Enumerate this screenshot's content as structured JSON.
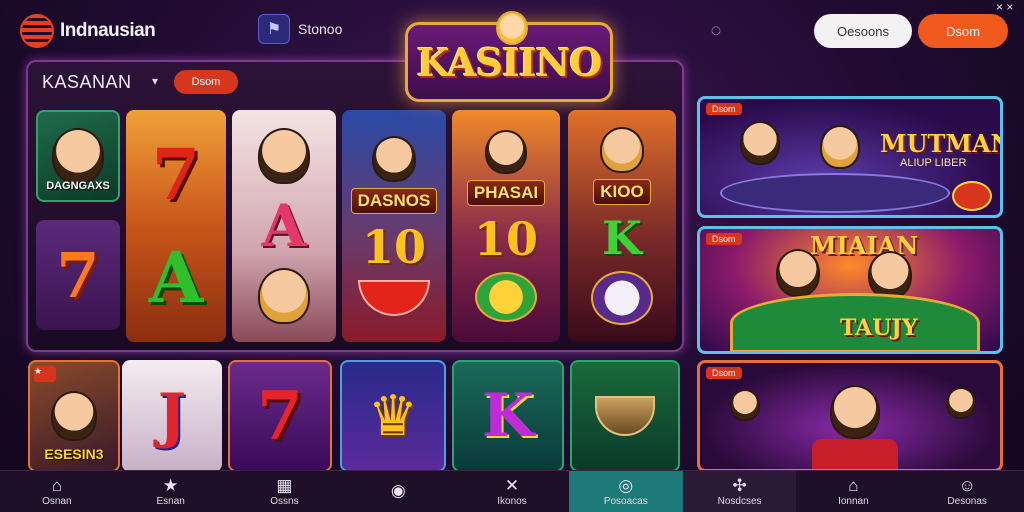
{
  "header": {
    "brand_name": "Indnausian",
    "store_label": "Stonoo",
    "logo_title": "KASIINO",
    "login_label": "Oesoons",
    "register_label": "Dsom",
    "close_glyph": "× ×"
  },
  "slot_panel": {
    "title": "KASANAN",
    "badge": "Dsom",
    "tiles": [
      {
        "caption": "DAGNGAXS"
      },
      {
        "symbol": "7"
      },
      {
        "symbol": "7"
      },
      {
        "symbol": "A"
      },
      {
        "symbol": "A"
      },
      {
        "label": "DASNOS",
        "value": "10"
      },
      {
        "label": "PHASAI",
        "value": "10"
      },
      {
        "label": "KIOO",
        "value": "K"
      }
    ]
  },
  "promos": [
    {
      "tag": "Dsom",
      "title": "MUTMANN",
      "subtitle": "ALIUP LIBER"
    },
    {
      "tag": "Dsom",
      "title": "MIAIAN",
      "subtitle": "TAUJY"
    },
    {
      "tag": "Dsom",
      "title": ""
    }
  ],
  "bottom_tiles": [
    {
      "caption": "ESESIN3"
    },
    {
      "symbol": "J"
    },
    {
      "symbol": "7"
    },
    {
      "symbol": ""
    },
    {
      "symbol": "K"
    },
    {
      "symbol": ""
    }
  ],
  "nav": [
    {
      "label": "Osnan",
      "icon": "home-icon",
      "glyph": "⌂"
    },
    {
      "label": "Esnan",
      "icon": "star-icon",
      "glyph": "★"
    },
    {
      "label": "Ossns",
      "icon": "grid-icon",
      "glyph": "▦"
    },
    {
      "label": "",
      "icon": "eye-icon",
      "glyph": "◉"
    },
    {
      "label": "Ikonos",
      "icon": "cross-icon",
      "glyph": "✕"
    },
    {
      "label": "Posoacas",
      "icon": "chip-icon",
      "glyph": "◎"
    },
    {
      "label": "Nosdcses",
      "icon": "deck-icon",
      "glyph": "✣"
    },
    {
      "label": "Ionnan",
      "icon": "house-icon",
      "glyph": "⌂"
    },
    {
      "label": "Desonas",
      "icon": "chat-icon",
      "glyph": "☺"
    }
  ],
  "colors": {
    "accent": "#f05a1e",
    "badge": "#d5361d",
    "active_nav": "#1e7a78",
    "panel_border": "#7d3a8f"
  }
}
